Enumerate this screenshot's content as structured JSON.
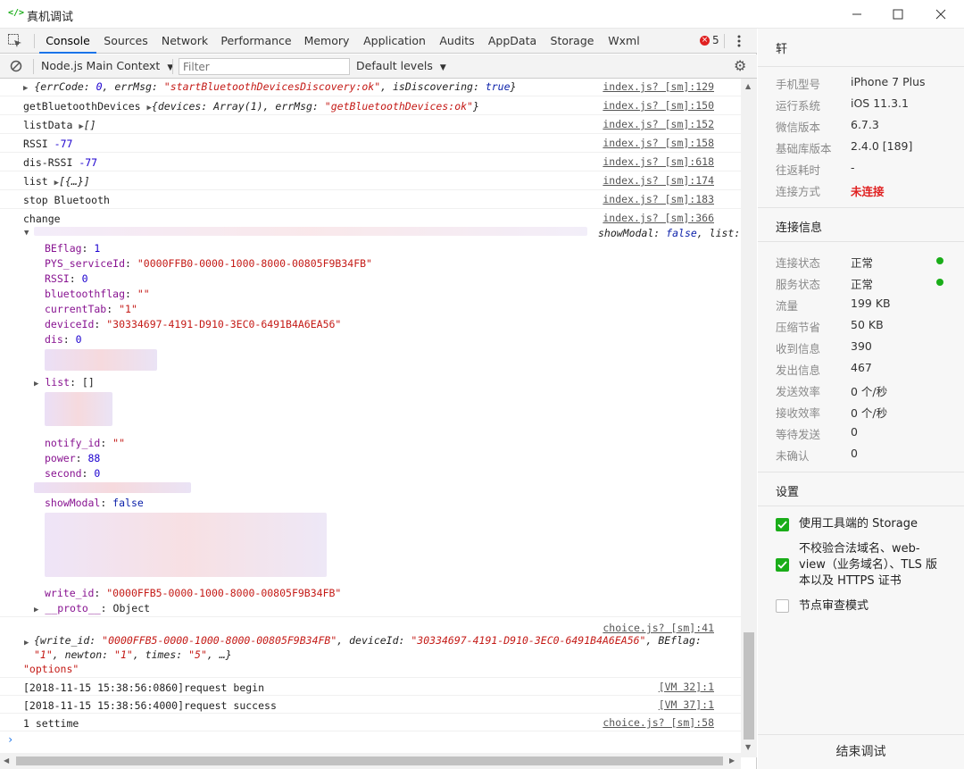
{
  "window": {
    "title": "真机调试",
    "icon": "code-bracket-icon"
  },
  "tabs": [
    "Console",
    "Sources",
    "Network",
    "Performance",
    "Memory",
    "Application",
    "Audits",
    "AppData",
    "Storage",
    "Wxml"
  ],
  "error_count": "5",
  "toolbar": {
    "context": "Node.js Main Context",
    "filter_placeholder": "Filter",
    "levels": "Default levels"
  },
  "logs": {
    "l1": {
      "text": "{errCode: 0, errMsg: \"startBluetoothDevicesDiscovery:ok\", isDiscovering: true}",
      "p1": "{errCode: ",
      "p2": "0",
      "p3": ", errMsg: ",
      "p4": "\"startBluetoothDevicesDiscovery:ok\"",
      "p5": ", isDiscovering: ",
      "p6": "true",
      "p7": "}",
      "src": "index.js? [sm]:129"
    },
    "l2": {
      "label": "getBluetoothDevices",
      "p1": "{devices: Array(1), errMsg: ",
      "p2": "\"getBluetoothDevices:ok\"",
      "p3": "}",
      "src": "index.js? [sm]:150"
    },
    "l3": {
      "label": "listData",
      "val": "[]",
      "src": "index.js? [sm]:152"
    },
    "l4": {
      "label": "RSSI",
      "val": "-77",
      "src": "index.js? [sm]:158"
    },
    "l5": {
      "label": "dis-RSSI",
      "val": "-77",
      "src": "index.js? [sm]:618"
    },
    "l6": {
      "label": "list",
      "val": "[{…}]",
      "src": "index.js? [sm]:174"
    },
    "l7": {
      "label": "stop Bluetooth",
      "src": "index.js? [sm]:183"
    },
    "l8": {
      "label": "change",
      "src": "index.js? [sm]:366"
    },
    "l9": {
      "p1": "showModal: ",
      "p2": "false",
      "p3": ", list:"
    }
  },
  "obj": {
    "BEflag_k": "BEflag",
    "BEflag_v": "1",
    "PYS_k": "PYS_serviceId",
    "PYS_v": "\"0000FFB0-0000-1000-8000-00805F9B34FB\"",
    "RSSI_k": "RSSI",
    "RSSI_v": "0",
    "bt_k": "bluetoothflag",
    "bt_v": "\"\"",
    "ct_k": "currentTab",
    "ct_v": "\"1\"",
    "dev_k": "deviceId",
    "dev_v": "\"30334697-4191-D910-3EC0-6491B4A6EA56\"",
    "dis_k": "dis",
    "dis_v": "0",
    "list_k": "list",
    "list_v": "[]",
    "nid_k": "notify_id",
    "nid_v": "\"\"",
    "pow_k": "power",
    "pow_v": "88",
    "sec_k": "second",
    "sec_v": "0",
    "sm_k": "showModal",
    "sm_v": "false",
    "wid_k": "write_id",
    "wid_v": "\"0000FFB5-0000-1000-8000-00805F9B34FB\"",
    "proto_k": "__proto__",
    "proto_v": "Object"
  },
  "log_choice": {
    "src": "choice.js? [sm]:41",
    "a1": "{write_id: ",
    "a2": "\"0000FFB5-0000-1000-8000-00805F9B34FB\"",
    "a3": ", deviceId: ",
    "a4": "\"30334697-4191-D910-3EC0-6491B4A6EA56\"",
    "a5": ", BEflag:",
    "b1": "\"1\"",
    "b2": ", newton: ",
    "b3": "\"1\"",
    "b4": ", times: ",
    "b5": "\"5\"",
    "b6": ", …}",
    "c1": "\"options\""
  },
  "log_tail": [
    {
      "text": "[2018-11-15 15:38:56:0860]request begin",
      "src": "[VM 32]:1"
    },
    {
      "text": "[2018-11-15 15:38:56:4000]request success",
      "src": "[VM 37]:1"
    },
    {
      "text": "1 settime",
      "src": "choice.js? [sm]:58"
    }
  ],
  "panel": {
    "user": "轩",
    "info": [
      {
        "k": "手机型号",
        "v": "iPhone 7 Plus"
      },
      {
        "k": "运行系统",
        "v": "iOS 11.3.1"
      },
      {
        "k": "微信版本",
        "v": "6.7.3"
      },
      {
        "k": "基础库版本",
        "v": "2.4.0 [189]"
      },
      {
        "k": "往返耗时",
        "v": "-"
      },
      {
        "k": "连接方式",
        "v": "未连接"
      }
    ],
    "conn_title": "连接信息",
    "conn": [
      {
        "k": "连接状态",
        "v": "正常"
      },
      {
        "k": "服务状态",
        "v": "正常"
      },
      {
        "k": "流量",
        "v": "199 KB"
      },
      {
        "k": "压缩节省",
        "v": "50 KB"
      },
      {
        "k": "收到信息",
        "v": "390"
      },
      {
        "k": "发出信息",
        "v": "467"
      },
      {
        "k": "发送效率",
        "v": "0 个/秒"
      },
      {
        "k": "接收效率",
        "v": "0 个/秒"
      },
      {
        "k": "等待发送",
        "v": "0"
      },
      {
        "k": "未确认",
        "v": "0"
      }
    ],
    "settings_title": "设置",
    "settings": [
      {
        "label": "使用工具端的 Storage",
        "checked": true
      },
      {
        "label": "不校验合法域名、web-view（业务域名）、TLS 版本以及 HTTPS 证书",
        "checked": true
      },
      {
        "label": "节点审查模式",
        "checked": false
      }
    ],
    "settings_line2_a": "不校验合法域名、web-",
    "settings_line2_b": "view（业务域名）、TLS 版",
    "settings_line2_c": "本以及 HTTPS 证书",
    "end_button": "结束调试",
    "colors": {
      "accent": "#1aad19",
      "warn": "#e02020"
    }
  }
}
